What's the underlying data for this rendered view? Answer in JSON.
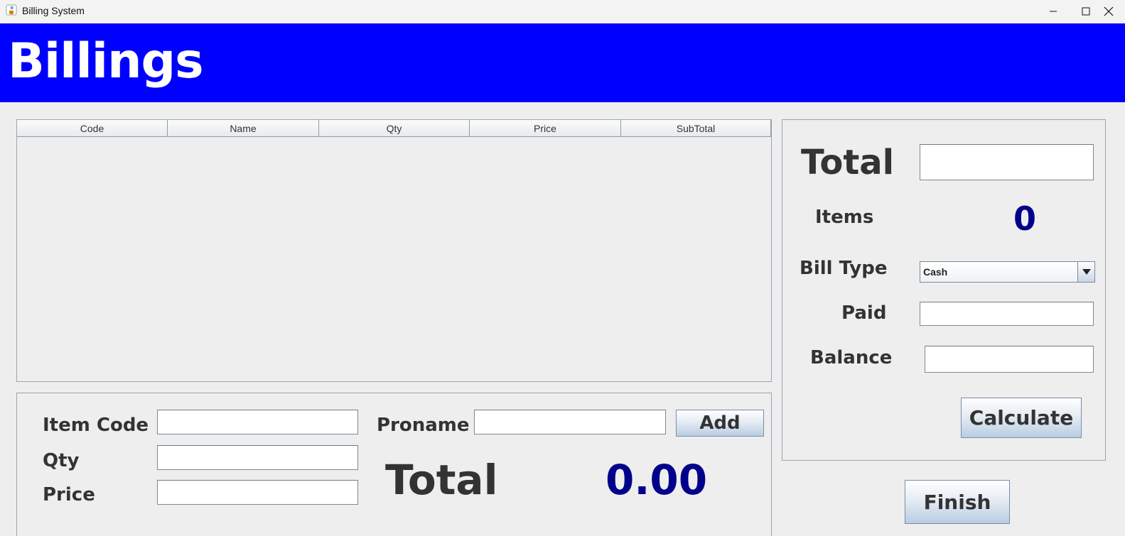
{
  "window": {
    "title": "Billing System"
  },
  "header": {
    "title": "Billings"
  },
  "table": {
    "columns": [
      "Code",
      "Name",
      "Qty",
      "Price",
      "SubTotal"
    ]
  },
  "entry": {
    "item_code_label": "Item Code",
    "qty_label": "Qty",
    "price_label": "Price",
    "proname_label": "Proname",
    "add_label": "Add",
    "total_label": "Total",
    "total_value": "0.00"
  },
  "summary": {
    "total_label": "Total",
    "items_label": "Items",
    "items_value": "0",
    "bill_type_label": "Bill Type",
    "bill_type_selected": "Cash",
    "paid_label": "Paid",
    "balance_label": "Balance",
    "calculate_label": "Calculate"
  },
  "finish_label": "Finish",
  "colors": {
    "header_bg": "#0000ff",
    "value_blue": "#00008b",
    "label_text": "#333333"
  }
}
